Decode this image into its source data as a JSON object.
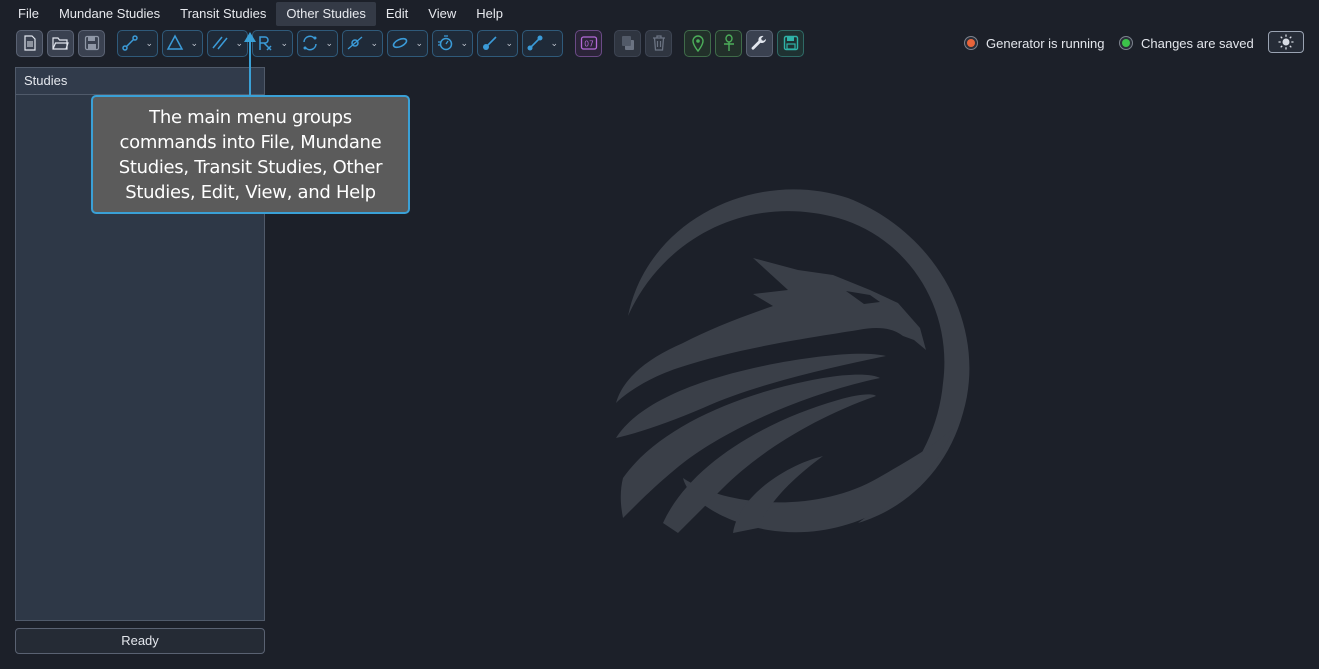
{
  "menu": {
    "items": [
      {
        "label": "File"
      },
      {
        "label": "Mundane Studies"
      },
      {
        "label": "Transit Studies"
      },
      {
        "label": "Other Studies",
        "active": true
      },
      {
        "label": "Edit"
      },
      {
        "label": "View"
      },
      {
        "label": "Help"
      }
    ]
  },
  "toolbar": {
    "file_buttons": [
      "new-document-icon",
      "open-folder-icon",
      "save-icon"
    ],
    "study_dropdowns": [
      "connection-icon",
      "triangle-icon",
      "parallel-lines-icon",
      "rx-icon",
      "cycle-icon",
      "orbit-icon",
      "ring-icon",
      "timer-icon",
      "pen-icon",
      "link-icon"
    ],
    "calendar_label": "07",
    "colors": {
      "accent_blue": "#3b9bd8",
      "green": "#4cae5a",
      "purple": "#b46ad8",
      "teal": "#2fb3a8"
    }
  },
  "status": {
    "generator": {
      "label": "Generator is running",
      "color": "#e8643a"
    },
    "saved": {
      "label": "Changes are saved",
      "color": "#3cc34a"
    }
  },
  "studies": {
    "header": "Studies"
  },
  "statusbar": {
    "text": "Ready"
  },
  "callout": {
    "text": "The main menu groups commands into File, Mundane Studies, Transit Studies, Other Studies, Edit, View, and Help",
    "border_color": "#3aa0d6"
  }
}
